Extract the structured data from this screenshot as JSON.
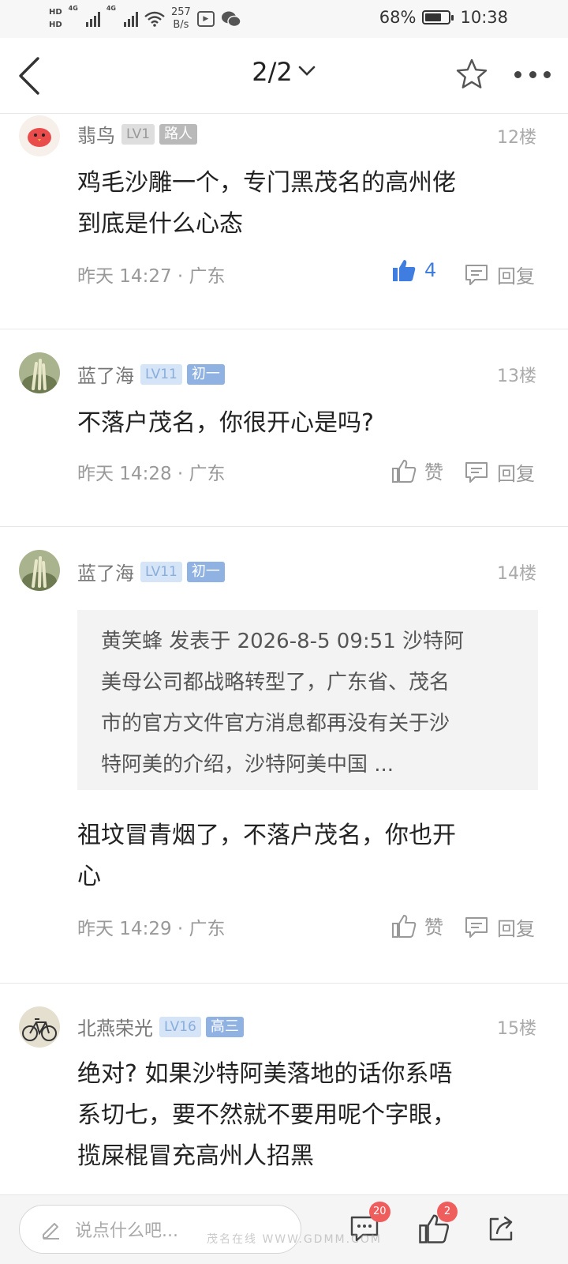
{
  "status_bar": {
    "hd1": "HD",
    "hd2": "HD",
    "net1": "4G",
    "net2": "4G",
    "speed_value": "257",
    "speed_unit": "B/s",
    "battery": "68%",
    "battery_level": 0.68,
    "time": "10:38",
    "notif_icons": [
      "video-app-icon",
      "wechat-icon"
    ]
  },
  "header": {
    "page_indicator": "2/2"
  },
  "posts": [
    {
      "username": "翡鸟",
      "level": "LV1",
      "title": "路人",
      "floor": "12楼",
      "content_lines": [
        "鸡毛沙雕一个，专门黑茂名的高州佬",
        "到底是什么心态"
      ],
      "time": "昨天 14:27 · 广东",
      "like_label": "4",
      "liked": true,
      "reply_label": "回复"
    },
    {
      "username": "蓝了海",
      "level": "LV11",
      "title": "初一",
      "floor": "13楼",
      "content_lines": [
        "不落户茂名，你很开心是吗?"
      ],
      "time": "昨天 14:28 · 广东",
      "like_label": "赞",
      "liked": false,
      "reply_label": "回复"
    },
    {
      "username": "蓝了海",
      "level": "LV11",
      "title": "初一",
      "floor": "14楼",
      "quote_lines": [
        "黄笑蜂 发表于 2026-8-5 09:51 沙特阿",
        "美母公司都战略转型了，广东省、茂名",
        "市的官方文件官方消息都再没有关于沙",
        "特阿美的介绍，沙特阿美中国 ..."
      ],
      "content_lines": [
        "祖坟冒青烟了，不落户茂名，你也开",
        "心"
      ],
      "time": "昨天 14:29 · 广东",
      "like_label": "赞",
      "liked": false,
      "reply_label": "回复"
    },
    {
      "username": "北燕荣光",
      "level": "LV16",
      "title": "高三",
      "floor": "15楼",
      "content_lines": [
        "绝对? 如果沙特阿美落地的话你系唔",
        "系切七，要不然就不要用呢个字眼，",
        "揽屎棍冒充高州人招黑"
      ]
    }
  ],
  "bottom_bar": {
    "input_placeholder": "说点什么吧...",
    "comment_count": "20",
    "like_count": "2"
  },
  "watermark": "茂名在线 WWW.GDMM.COM"
}
